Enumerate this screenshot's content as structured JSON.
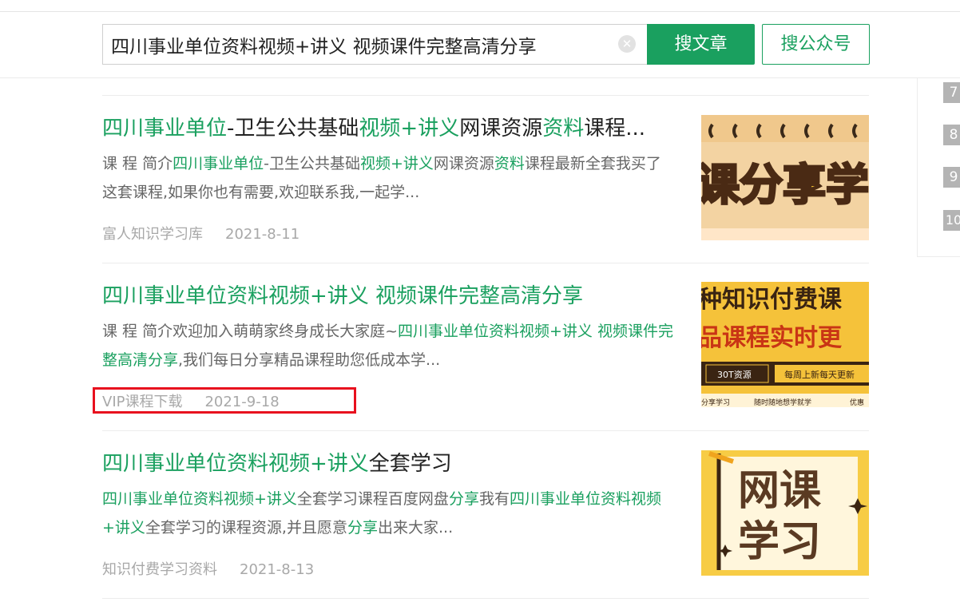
{
  "search": {
    "query": "四川事业单位资料视频+讲义 视频课件完整高清分享",
    "article_button": "搜文章",
    "account_button": "搜公众号"
  },
  "sidebar": {
    "ranks": [
      "7",
      "8",
      "9",
      "10"
    ]
  },
  "results": [
    {
      "title_parts": [
        {
          "t": "四川事业单位",
          "hl": true
        },
        {
          "t": "-卫生公共基础",
          "hl": false
        },
        {
          "t": "视频+讲义",
          "hl": true
        },
        {
          "t": "网课资源",
          "hl": false
        },
        {
          "t": "资料",
          "hl": true
        },
        {
          "t": "课程...",
          "hl": false
        }
      ],
      "desc_parts": [
        {
          "t": "课 程 简介",
          "hl": false
        },
        {
          "t": "四川事业单位",
          "hl": true
        },
        {
          "t": "-卫生公共基础",
          "hl": false
        },
        {
          "t": "视频+讲义",
          "hl": true
        },
        {
          "t": "网课资源",
          "hl": false
        },
        {
          "t": "资料",
          "hl": true
        },
        {
          "t": "课程最新全套我买了这套课程,如果你也有需要,欢迎联系我,一起学...",
          "hl": false
        }
      ],
      "source": "富人知识学习库",
      "date": "2021-8-11",
      "thumb_text": "课分享学"
    },
    {
      "title_parts": [
        {
          "t": "四川事业单位资料视频+讲义 视频课件完整高清分享",
          "hl": true
        }
      ],
      "desc_parts": [
        {
          "t": "课 程 简介欢迎加入萌萌家终身成长大家庭~",
          "hl": false
        },
        {
          "t": "四川事业单位资料视频+讲义 视频课件完整高清分享",
          "hl": true
        },
        {
          "t": ",我们每日分享精品课程助您低成本学...",
          "hl": false
        }
      ],
      "source": "VIP课程下载",
      "date": "2021-9-18",
      "thumb_lines": [
        "种知识付费课",
        "品课程实时更",
        "30T资源",
        "每周上新每天更新",
        "分享学习",
        "随时随地想学就学",
        "优惠"
      ]
    },
    {
      "title_parts": [
        {
          "t": "四川事业单位资料视频+讲义",
          "hl": true
        },
        {
          "t": "全套学习",
          "hl": false
        }
      ],
      "desc_parts": [
        {
          "t": "四川事业单位资料视频+讲义",
          "hl": true
        },
        {
          "t": "全套学习课程百度网盘",
          "hl": false
        },
        {
          "t": "分享",
          "hl": true
        },
        {
          "t": "我有",
          "hl": false
        },
        {
          "t": "四川事业单位资料视频+讲义",
          "hl": true
        },
        {
          "t": "全套学习的课程资源,并且愿意",
          "hl": false
        },
        {
          "t": "分享",
          "hl": true
        },
        {
          "t": "出来大家...",
          "hl": false
        }
      ],
      "source": "知识付费学习资料",
      "date": "2021-8-13",
      "thumb_lines": [
        "网课",
        "学习"
      ]
    }
  ],
  "colors": {
    "accent": "#1aa05f",
    "highlight_box": "#e8101e"
  }
}
